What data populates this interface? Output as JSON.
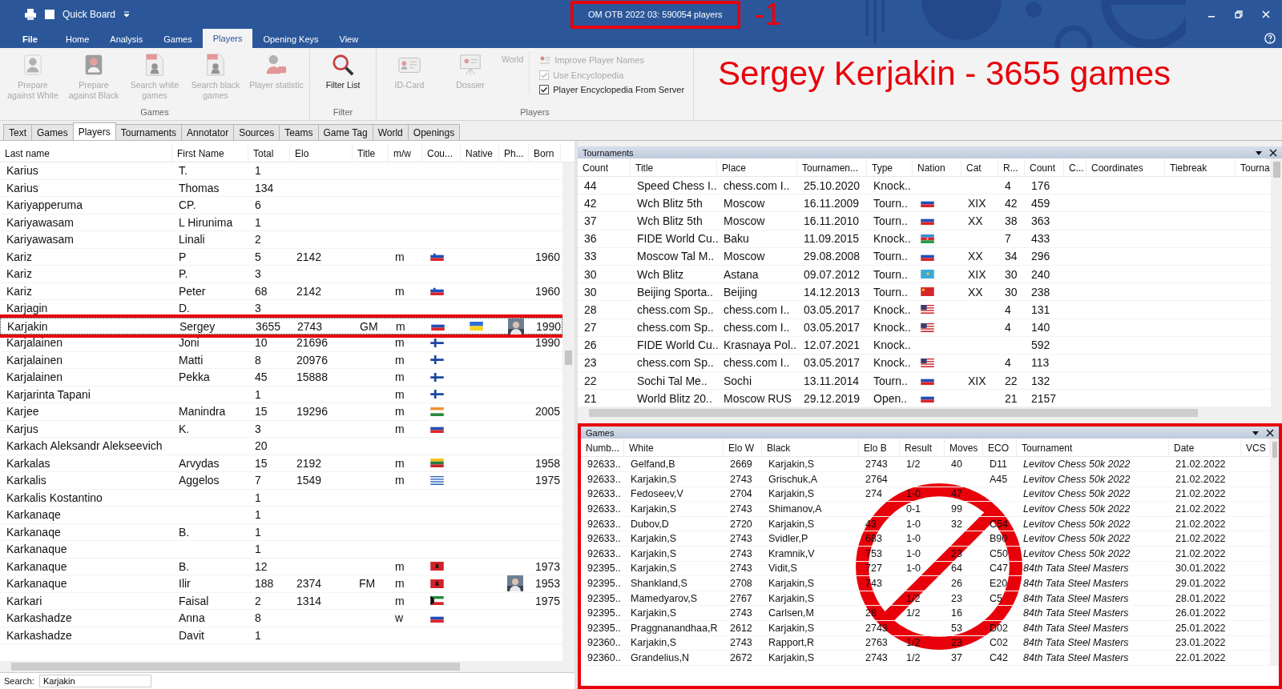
{
  "window": {
    "quick_access": "Quick Board",
    "title": "OM OTB 2022 03:  590054 players",
    "marker": "-1"
  },
  "ribbon": {
    "tabs": [
      {
        "label": "File",
        "selected": false
      },
      {
        "label": "Home",
        "selected": false
      },
      {
        "label": "Analysis",
        "selected": false
      },
      {
        "label": "Games",
        "selected": false
      },
      {
        "label": "Players",
        "selected": true
      },
      {
        "label": "Opening Keys",
        "selected": false
      },
      {
        "label": "View",
        "selected": false
      }
    ],
    "groups": [
      {
        "title": "Games",
        "buttons": [
          {
            "label": "Prepare against White",
            "disabled": true
          },
          {
            "label": "Prepare against Black",
            "disabled": true
          },
          {
            "label": "Search white games",
            "disabled": true
          },
          {
            "label": "Search black games",
            "disabled": true
          },
          {
            "label": "Player statistic",
            "disabled": true
          }
        ]
      },
      {
        "title": "Filter",
        "buttons": [
          {
            "label": "Filter List",
            "disabled": false
          }
        ]
      },
      {
        "title": "Players",
        "buttons": [
          {
            "label": "ID-Card",
            "disabled": true
          },
          {
            "label": "Dossier",
            "disabled": true
          },
          {
            "label": "World",
            "disabled": true
          }
        ],
        "options": [
          {
            "kind": "command",
            "label": "Improve Player Names",
            "disabled": true
          },
          {
            "kind": "checkbox",
            "label": "Use Encyclopedia",
            "checked": true,
            "disabled": true
          },
          {
            "kind": "checkbox",
            "label": "Player Encyclopedia From Server",
            "checked": true,
            "disabled": false
          }
        ]
      }
    ]
  },
  "headline": "Sergey Kerjakin - 3655 games",
  "doc_tabs": [
    {
      "label": "Text",
      "selected": false
    },
    {
      "label": "Games",
      "selected": false
    },
    {
      "label": "Players",
      "selected": true
    },
    {
      "label": "Tournaments",
      "selected": false
    },
    {
      "label": "Annotator",
      "selected": false
    },
    {
      "label": "Sources",
      "selected": false
    },
    {
      "label": "Teams",
      "selected": false
    },
    {
      "label": "Game Tag",
      "selected": false
    },
    {
      "label": "World",
      "selected": false
    },
    {
      "label": "Openings",
      "selected": false
    }
  ],
  "players": {
    "columns": [
      "Last name",
      "First Name",
      "Total",
      "Elo",
      "Title",
      "m/w",
      "Cou...",
      "Native",
      "Ph...",
      "Born"
    ],
    "rows": [
      {
        "last": "Karius",
        "first": "T.",
        "total": "1",
        "selected": false
      },
      {
        "last": "Karius",
        "first": "Thomas",
        "total": "134",
        "selected": false
      },
      {
        "last": "Kariyapperuma",
        "first": "CP.",
        "total": "6",
        "selected": false
      },
      {
        "last": "Kariyawasam",
        "first": "L Hirunima",
        "total": "1",
        "selected": false
      },
      {
        "last": "Kariyawasam",
        "first": "Linali",
        "total": "2",
        "selected": false
      },
      {
        "last": "Kariz",
        "first": "P",
        "total": "5",
        "elo": "2142",
        "mw": "m",
        "country": {
          "kind": "si"
        },
        "born": "1960",
        "selected": false
      },
      {
        "last": "Kariz",
        "first": "P.",
        "total": "3",
        "selected": false
      },
      {
        "last": "Kariz",
        "first": "Peter",
        "total": "68",
        "elo": "2142",
        "mw": "m",
        "country": {
          "kind": "si"
        },
        "born": "1960",
        "selected": false
      },
      {
        "last": "Karjagin",
        "first": "D.",
        "total": "3",
        "selected": false
      },
      {
        "last": "Karjakin",
        "first": "Sergey",
        "total": "3655",
        "elo": "2743",
        "title": "GM",
        "mw": "m",
        "country": {
          "kind": "ru"
        },
        "native": {
          "kind": "ua"
        },
        "born": "1990",
        "selected": true
      },
      {
        "last": "Karjalainen",
        "first": "Joni",
        "total": "10",
        "elo": "21696",
        "mw": "m",
        "country": {
          "kind": "fi"
        },
        "born": "1990",
        "selected": false
      },
      {
        "last": "Karjalainen",
        "first": "Matti",
        "total": "8",
        "elo": "20976",
        "mw": "m",
        "country": {
          "kind": "fi"
        },
        "selected": false
      },
      {
        "last": "Karjalainen",
        "first": "Pekka",
        "total": "45",
        "elo": "15888",
        "mw": "m",
        "country": {
          "kind": "fi"
        },
        "selected": false
      },
      {
        "last": "Karjarinta Tapani",
        "total": "1",
        "mw": "m",
        "country": {
          "kind": "fi"
        },
        "selected": false
      },
      {
        "last": "Karjee",
        "first": "Manindra",
        "total": "15",
        "elo": "19296",
        "mw": "m",
        "country": {
          "kind": "in"
        },
        "born": "2005",
        "selected": false
      },
      {
        "last": "Karjus",
        "first": "K.",
        "total": "3",
        "mw": "m",
        "country": {
          "kind": "ru"
        },
        "selected": false
      },
      {
        "last": "Karkach Aleksandr Alekseevich",
        "total": "20",
        "selected": false
      },
      {
        "last": "Karkalas",
        "first": "Arvydas",
        "total": "15",
        "elo": "2192",
        "mw": "m",
        "country": {
          "kind": "lt"
        },
        "born": "1958",
        "selected": false
      },
      {
        "last": "Karkalis",
        "first": "Aggelos",
        "total": "7",
        "elo": "1549",
        "mw": "m",
        "country": {
          "kind": "gr"
        },
        "born": "1975",
        "selected": false
      },
      {
        "last": "Karkalis Kostantino",
        "total": "1",
        "selected": false
      },
      {
        "last": "Karkanaqe",
        "total": "1",
        "selected": false
      },
      {
        "last": "Karkanaqe",
        "first": "B.",
        "total": "1",
        "selected": false
      },
      {
        "last": "Karkanaque",
        "total": "1",
        "selected": false
      },
      {
        "last": "Karkanaque",
        "first": "B.",
        "total": "12",
        "mw": "m",
        "country": {
          "kind": "al"
        },
        "born": "1973",
        "selected": false
      },
      {
        "last": "Karkanaque",
        "first": "Ilir",
        "total": "188",
        "elo": "2374",
        "title": "FM",
        "mw": "m",
        "country": {
          "kind": "al"
        },
        "born": "1953",
        "selected": false
      },
      {
        "last": "Karkari",
        "first": "Faisal",
        "total": "2",
        "elo": "1314",
        "mw": "m",
        "country": {
          "kind": "kw"
        },
        "born": "1975",
        "selected": false
      },
      {
        "last": "Karkashadze",
        "first": "Anna",
        "total": "8",
        "mw": "w",
        "country": {
          "kind": "ru"
        },
        "selected": false
      },
      {
        "last": "Karkashadze",
        "first": "Davit",
        "total": "1",
        "selected": false
      }
    ]
  },
  "search": {
    "label": "Search:",
    "value": "Karjakin"
  },
  "tournaments": {
    "title": "Tournaments",
    "columns": [
      "Count",
      "Title",
      "Place",
      "Tournamen...",
      "Type",
      "Nation",
      "Cat",
      "R...",
      "Count",
      "C...",
      "Coordinates",
      "Tiebreak",
      "Tourna"
    ],
    "rows": [
      {
        "count": "44",
        "title": "Speed Chess I..",
        "place": "chess.com I..",
        "date": "25.10.2020",
        "type": "Knock..",
        "rounds": "4",
        "games": "176"
      },
      {
        "count": "42",
        "title": "Wch Blitz 5th",
        "place": "Moscow",
        "date": "16.11.2009",
        "type": "Tourn..",
        "nation": {
          "kind": "ru"
        },
        "cat": "XIX",
        "rounds": "42",
        "games": "459"
      },
      {
        "count": "37",
        "title": "Wch Blitz 5th",
        "place": "Moscow",
        "date": "16.11.2010",
        "type": "Tourn..",
        "nation": {
          "kind": "ru"
        },
        "cat": "XX",
        "rounds": "38",
        "games": "363"
      },
      {
        "count": "36",
        "title": "FIDE World Cu..",
        "place": "Baku",
        "date": "11.09.2015",
        "type": "Knock..",
        "nation": {
          "kind": "az"
        },
        "rounds": "7",
        "games": "433"
      },
      {
        "count": "33",
        "title": "Moscow Tal M..",
        "place": "Moscow",
        "date": "29.08.2008",
        "type": "Tourn..",
        "nation": {
          "kind": "ru"
        },
        "cat": "XX",
        "rounds": "34",
        "games": "296"
      },
      {
        "count": "30",
        "title": "Wch Blitz",
        "place": "Astana",
        "date": "09.07.2012",
        "type": "Tourn..",
        "nation": {
          "kind": "kz"
        },
        "cat": "XIX",
        "rounds": "30",
        "games": "240"
      },
      {
        "count": "30",
        "title": "Beijing Sporta..",
        "place": "Beijing",
        "date": "14.12.2013",
        "type": "Tourn..",
        "nation": {
          "kind": "cn"
        },
        "cat": "XX",
        "rounds": "30",
        "games": "238"
      },
      {
        "count": "28",
        "title": "chess.com Sp..",
        "place": "chess.com I..",
        "date": "03.05.2017",
        "type": "Knock..",
        "nation": {
          "kind": "us"
        },
        "rounds": "4",
        "games": "131"
      },
      {
        "count": "27",
        "title": "chess.com Sp..",
        "place": "chess.com I..",
        "date": "03.05.2017",
        "type": "Knock..",
        "nation": {
          "kind": "us"
        },
        "rounds": "4",
        "games": "140"
      },
      {
        "count": "26",
        "title": "FIDE World Cu..",
        "place": "Krasnaya Pol..",
        "date": "12.07.2021",
        "type": "Knock..",
        "games": "592"
      },
      {
        "count": "23",
        "title": "chess.com Sp..",
        "place": "chess.com I..",
        "date": "03.05.2017",
        "type": "Knock..",
        "nation": {
          "kind": "us"
        },
        "rounds": "4",
        "games": "113"
      },
      {
        "count": "22",
        "title": "Sochi Tal Me..",
        "place": "Sochi",
        "date": "13.11.2014",
        "type": "Tourn..",
        "nation": {
          "kind": "ru"
        },
        "cat": "XIX",
        "rounds": "22",
        "games": "132"
      },
      {
        "count": "21",
        "title": "World Blitz 20..",
        "place": "Moscow RUS",
        "date": "29.12.2019",
        "type": "Open..",
        "nation": {
          "kind": "ru"
        },
        "rounds": "21",
        "games": "2157"
      }
    ]
  },
  "games": {
    "title": "Games",
    "columns": [
      "Numb...",
      "White",
      "Elo W",
      "Black",
      "Elo B",
      "Result",
      "Moves",
      "ECO",
      "Tournament",
      "Date",
      "VCS"
    ],
    "rows": [
      {
        "num": "92633..",
        "white": "Gelfand,B",
        "elo_w": "2669",
        "black": "Karjakin,S",
        "elo_b": "2743",
        "result": "1/2",
        "moves": "40",
        "eco": "D11",
        "tournament": "Levitov Chess 50k 2022",
        "date": "21.02.2022"
      },
      {
        "num": "92633..",
        "white": "Karjakin,S",
        "elo_w": "2743",
        "black": "Grischuk,A",
        "elo_b": "2764",
        "eco": "A45",
        "tournament": "Levitov Chess 50k 2022",
        "date": "21.02.2022"
      },
      {
        "num": "92633..",
        "white": "Fedoseev,V",
        "elo_w": "2704",
        "black": "Karjakin,S",
        "elo_b": "274",
        "result": "1-0",
        "moves": "47",
        "tournament": "Levitov Chess 50k 2022",
        "date": "21.02.2022"
      },
      {
        "num": "92633..",
        "white": "Karjakin,S",
        "elo_w": "2743",
        "black": "Shimanov,A",
        "result": "0-1",
        "moves": "99",
        "tournament": "Levitov Chess 50k 2022",
        "date": "21.02.2022"
      },
      {
        "num": "92633..",
        "white": "Dubov,D",
        "elo_w": "2720",
        "black": "Karjakin,S",
        "elo_b": "43",
        "result": "1-0",
        "moves": "32",
        "eco": "C54",
        "tournament": "Levitov Chess 50k 2022",
        "date": "21.02.2022"
      },
      {
        "num": "92633..",
        "white": "Karjakin,S",
        "elo_w": "2743",
        "black": "Svidler,P",
        "elo_b": "683",
        "result": "1-0",
        "eco": "B90",
        "tournament": "Levitov Chess 50k 2022",
        "date": "21.02.2022"
      },
      {
        "num": "92633..",
        "white": "Karjakin,S",
        "elo_w": "2743",
        "black": "Kramnik,V",
        "elo_b": "753",
        "result": "1-0",
        "moves": "23",
        "eco": "C50",
        "tournament": "Levitov Chess 50k 2022",
        "date": "21.02.2022"
      },
      {
        "num": "92395..",
        "white": "Karjakin,S",
        "elo_w": "2743",
        "black": "Vidit,S",
        "elo_b": "727",
        "result": "1-0",
        "moves": "64",
        "eco": "C47",
        "tournament": "84th Tata Steel Masters",
        "date": "30.01.2022"
      },
      {
        "num": "92395..",
        "white": "Shankland,S",
        "elo_w": "2708",
        "black": "Karjakin,S",
        "elo_b": "743",
        "moves": "26",
        "eco": "E20",
        "tournament": "84th Tata Steel Masters",
        "date": "29.01.2022"
      },
      {
        "num": "92395..",
        "white": "Mamedyarov,S",
        "elo_w": "2767",
        "black": "Karjakin,S",
        "result": "1/2",
        "moves": "23",
        "eco": "C5",
        "tournament": "84th Tata Steel Masters",
        "date": "28.01.2022"
      },
      {
        "num": "92395..",
        "white": "Karjakin,S",
        "elo_w": "2743",
        "black": "Carlsen,M",
        "elo_b": "28",
        "result": "1/2",
        "moves": "16",
        "tournament": "84th Tata Steel Masters",
        "date": "26.01.2022"
      },
      {
        "num": "92395..",
        "white": "Praggnanandhaa,R",
        "elo_w": "2612",
        "black": "Karjakin,S",
        "elo_b": "2743",
        "moves": "53",
        "eco": "D02",
        "tournament": "84th Tata Steel Masters",
        "date": "25.01.2022"
      },
      {
        "num": "92360..",
        "white": "Karjakin,S",
        "elo_w": "2743",
        "black": "Rapport,R",
        "elo_b": "2763",
        "result": "1/2",
        "moves": "23",
        "eco": "C02",
        "tournament": "84th Tata Steel Masters",
        "date": "23.01.2022"
      },
      {
        "num": "92360..",
        "white": "Grandelius,N",
        "elo_w": "2672",
        "black": "Karjakin,S",
        "elo_b": "2743",
        "result": "1/2",
        "moves": "37",
        "eco": "C42",
        "tournament": "84th Tata Steel Masters",
        "date": "22.01.2022"
      }
    ]
  }
}
